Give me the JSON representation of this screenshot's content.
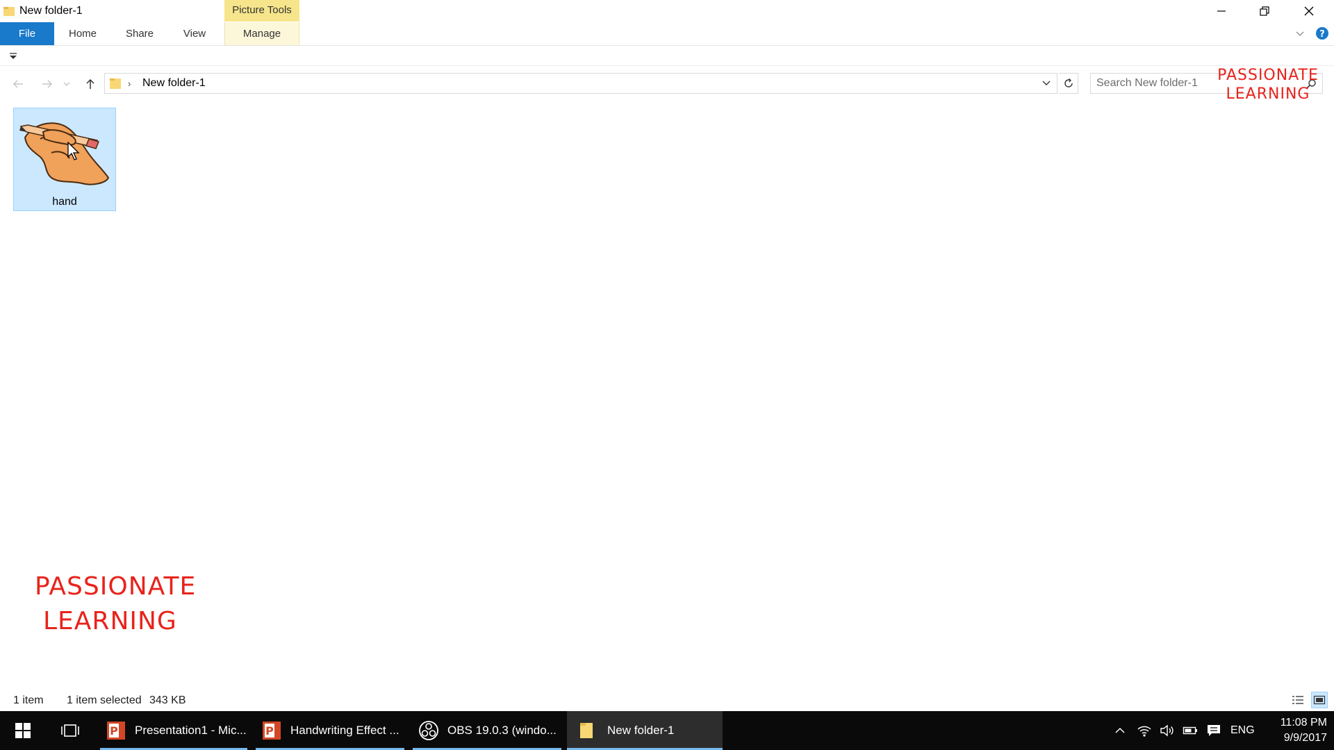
{
  "window": {
    "title": "New folder-1",
    "context_tab_header": "Picture Tools"
  },
  "ribbon": {
    "tabs": [
      {
        "label": "File"
      },
      {
        "label": "Home"
      },
      {
        "label": "Share"
      },
      {
        "label": "View"
      },
      {
        "label": "Manage"
      }
    ]
  },
  "address_bar": {
    "path": "New folder-1"
  },
  "search": {
    "placeholder": "Search New folder-1"
  },
  "watermark": {
    "line1": "PASSIONATE",
    "line2": "LEARNING"
  },
  "files": [
    {
      "name": "hand",
      "icon": "hand-pencil-thumbnail",
      "selected": true
    }
  ],
  "status_bar": {
    "item_count": "1 item",
    "selection": "1 item selected",
    "size": "343 KB"
  },
  "taskbar": {
    "apps": [
      {
        "label": "Presentation1 - Mic...",
        "icon": "powerpoint-icon"
      },
      {
        "label": "Handwriting Effect ...",
        "icon": "powerpoint-icon"
      },
      {
        "label": "OBS 19.0.3 (windo...",
        "icon": "obs-icon"
      },
      {
        "label": "New folder-1",
        "icon": "folder-icon",
        "active": true
      }
    ],
    "language": "ENG",
    "time": "11:08 PM",
    "date": "9/9/2017"
  },
  "colors": {
    "accent": "#1979ca",
    "selection": "#cce8ff",
    "context_tab": "#f6e58a",
    "watermark": "#e8231b"
  }
}
